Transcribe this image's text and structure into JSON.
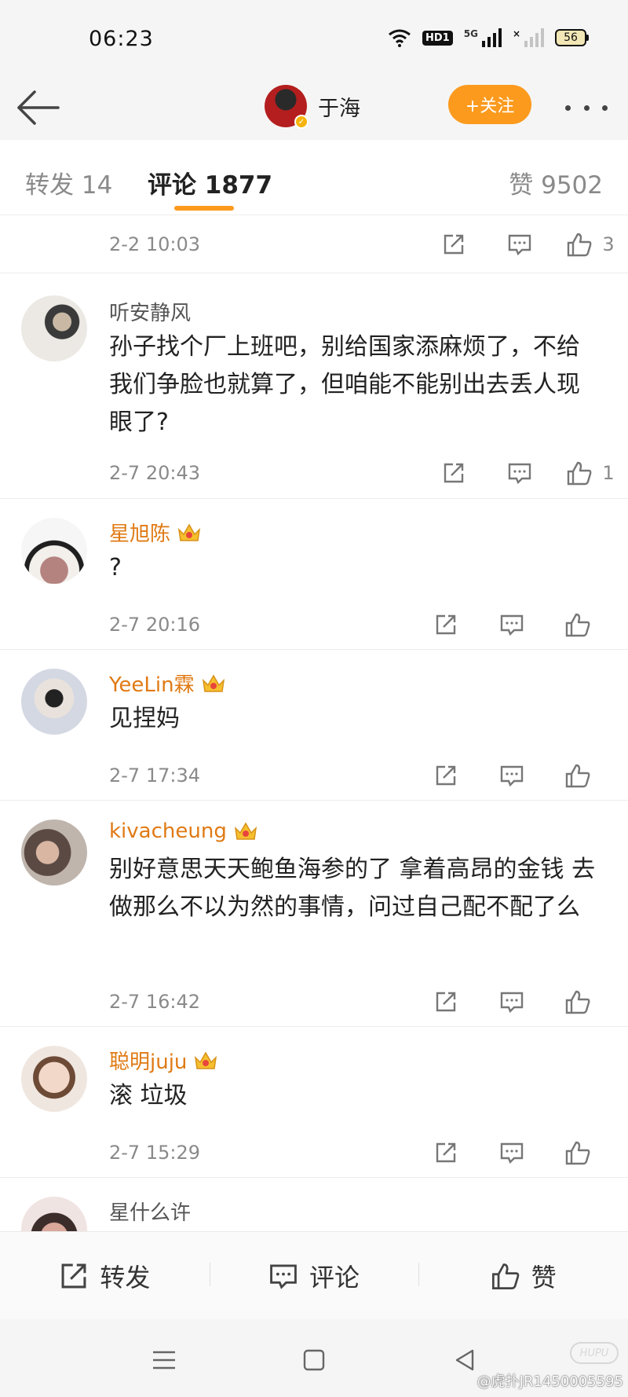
{
  "status_bar": {
    "time": "06:23",
    "network_badge": "HD1",
    "signal_label": "5G",
    "battery": "56"
  },
  "header": {
    "username": "于海",
    "follow_label": "+关注",
    "accent_color": "#fb9a1d"
  },
  "tabs": {
    "repost": "转发 14",
    "comment": "评论 1877",
    "like": "赞 9502"
  },
  "first_row": {
    "time": "2-2 10:03",
    "likes": "3"
  },
  "comments": [
    {
      "username": "听安静风",
      "vip": false,
      "text": "孙子找个厂上班吧，别给国家添麻烦了，不给我们争脸也就算了，但咱能不能别出去丢人现眼了?",
      "time": "2-7 20:43",
      "likes": "1"
    },
    {
      "username": "星旭陈",
      "vip": true,
      "text": "?",
      "time": "2-7 20:16",
      "likes": ""
    },
    {
      "username": "YeeLin霖",
      "vip": true,
      "text": "见捏妈",
      "time": "2-7 17:34",
      "likes": ""
    },
    {
      "username": "kivacheung",
      "vip": true,
      "text": "别好意思天天鲍鱼海参的了 拿着高昂的金钱 去做那么不以为然的事情，问过自己配不配了么",
      "time": "2-7 16:42",
      "likes": ""
    },
    {
      "username": "聪明juju",
      "vip": true,
      "text": "滚 垃圾",
      "time": "2-7 15:29",
      "likes": ""
    },
    {
      "username": "星什么许",
      "vip": false,
      "text": "",
      "time": "",
      "likes": ""
    }
  ],
  "bottom_bar": {
    "repost": "转发",
    "comment": "评论",
    "like": "赞"
  },
  "watermark": {
    "text": "@虎扑JR1450005595",
    "badge": "HUPU"
  }
}
